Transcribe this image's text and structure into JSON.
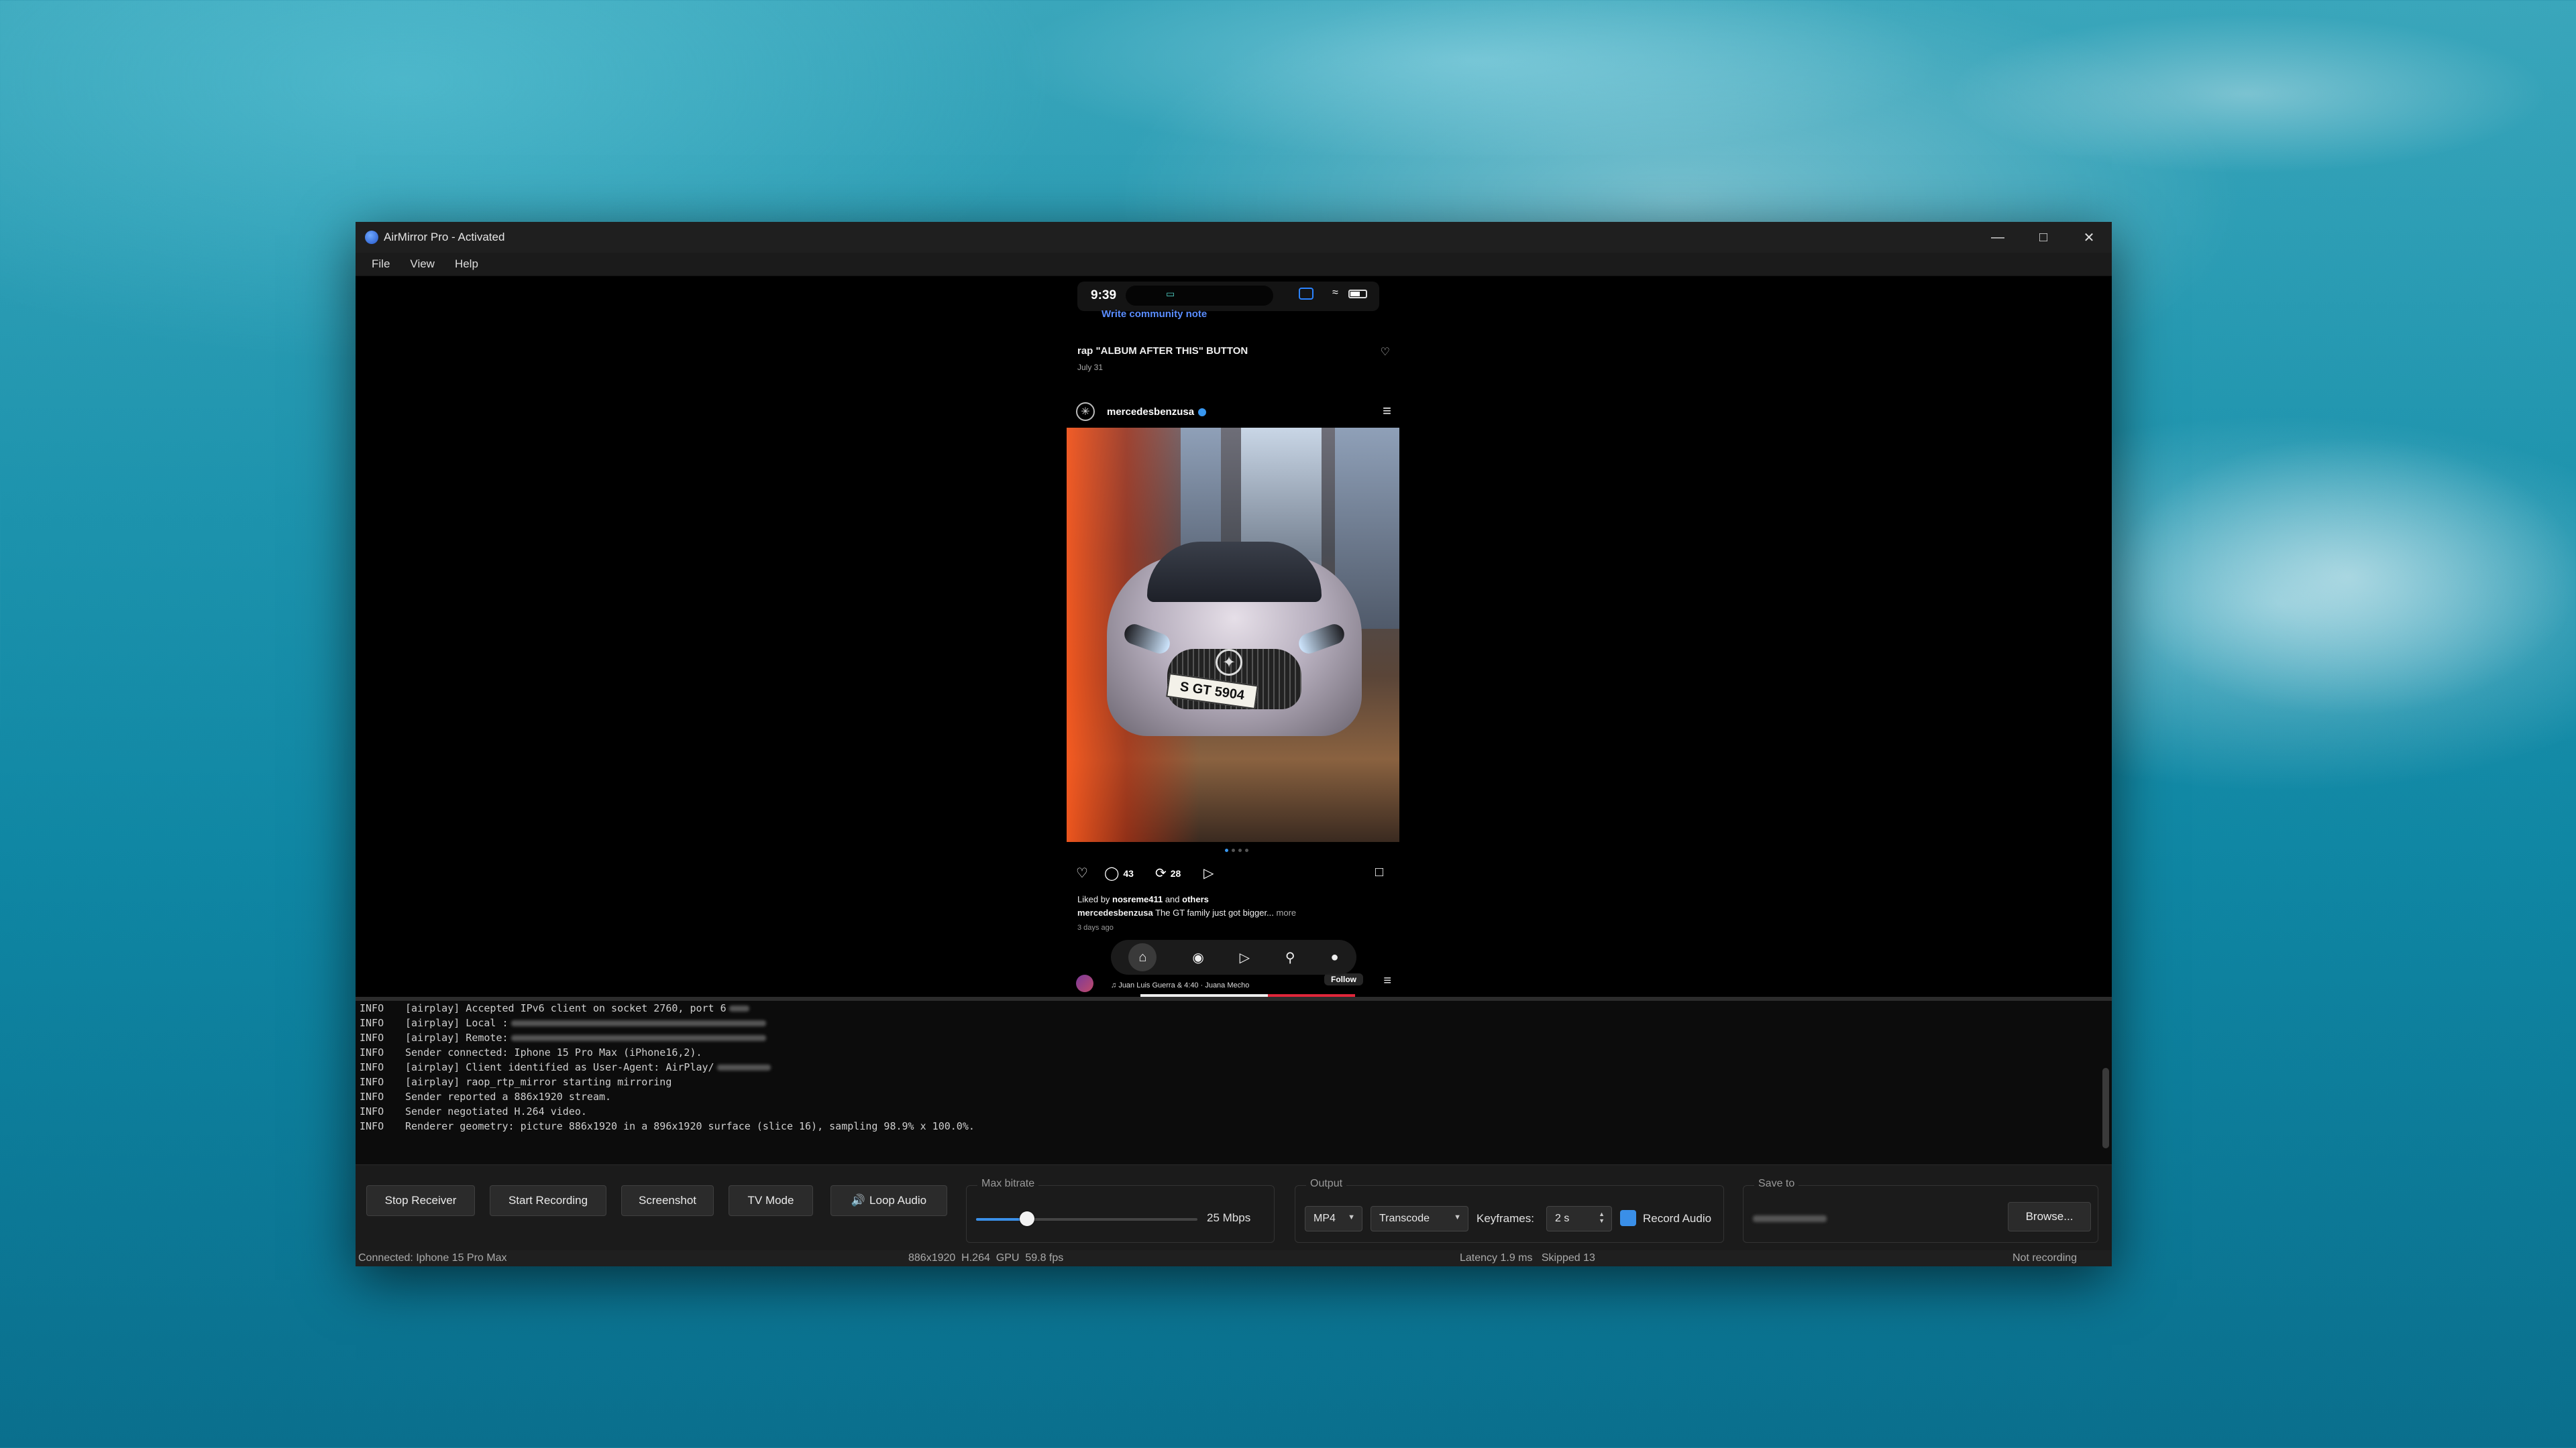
{
  "window": {
    "title": "AirMirror Pro - Activated",
    "controls": [
      "minimize-icon",
      "maximize-icon",
      "close-icon"
    ]
  },
  "menu": {
    "file": "File",
    "view": "View",
    "help": "Help"
  },
  "phone": {
    "status_time": "9:39",
    "community_note": "Write community note",
    "previous_post": {
      "caption": "rap \"ALBUM AFTER THIS\" BUTTON",
      "date": "July 31"
    },
    "post": {
      "username": "mercedesbenzusa",
      "plate": "S GT 5904",
      "comments": "43",
      "reposts": "28",
      "liked_by_prefix": "Liked by ",
      "liked_by_user": "nosreme411",
      "liked_by_suffix": " and ",
      "liked_by_others": "others",
      "caption_user": "mercedesbenzusa",
      "caption_text": " The GT family just got bigger...",
      "caption_more": " more",
      "time_ago": "3 days ago"
    },
    "next_post": {
      "music": "Juan Luis Guerra & 4:40 · Juana Mecho",
      "follow": "Follow"
    }
  },
  "log": [
    {
      "level": "INFO",
      "text": "[airplay] Accepted IPv6 client on socket 2760, port 6"
    },
    {
      "level": "INFO",
      "text": "[airplay] Local :"
    },
    {
      "level": "INFO",
      "text": "[airplay] Remote:"
    },
    {
      "level": "INFO",
      "text": "Sender connected: Iphone 15 Pro Max (iPhone16,2)."
    },
    {
      "level": "INFO",
      "text": "[airplay] Client identified as User-Agent: AirPlay/"
    },
    {
      "level": "INFO",
      "text": "[airplay] raop_rtp_mirror starting mirroring"
    },
    {
      "level": "INFO",
      "text": "Sender reported a 886x1920 stream."
    },
    {
      "level": "INFO",
      "text": "Sender negotiated H.264 video."
    },
    {
      "level": "INFO",
      "text": "Renderer geometry: picture 886x1920 in a 896x1920 surface (slice 16), sampling 98.9% x 100.0%."
    }
  ],
  "controls": {
    "stop_receiver": "Stop Receiver",
    "start_recording": "Start Recording",
    "screenshot": "Screenshot",
    "tv_mode": "TV Mode",
    "loop_audio": "Loop Audio",
    "bitrate_label": "Max bitrate",
    "bitrate_value": "25 Mbps",
    "bitrate_fraction": 0.23,
    "output_label": "Output",
    "format": "MP4",
    "mode": "Transcode",
    "keyframes_label": "Keyframes:",
    "keyframes_value": "2 s",
    "record_audio": "Record Audio",
    "record_audio_checked": true,
    "save_to_label": "Save to",
    "browse": "Browse..."
  },
  "status": {
    "connected": "Connected: Iphone 15 Pro Max",
    "stream": "886x1920  H.264  GPU  59.8 fps",
    "latency": "Latency 1.9 ms   Skipped 13",
    "recording": "Not recording"
  },
  "colors": {
    "accent": "#3a8fe8",
    "window_bg": "#000000",
    "panel_bg": "#1b1b1b"
  }
}
